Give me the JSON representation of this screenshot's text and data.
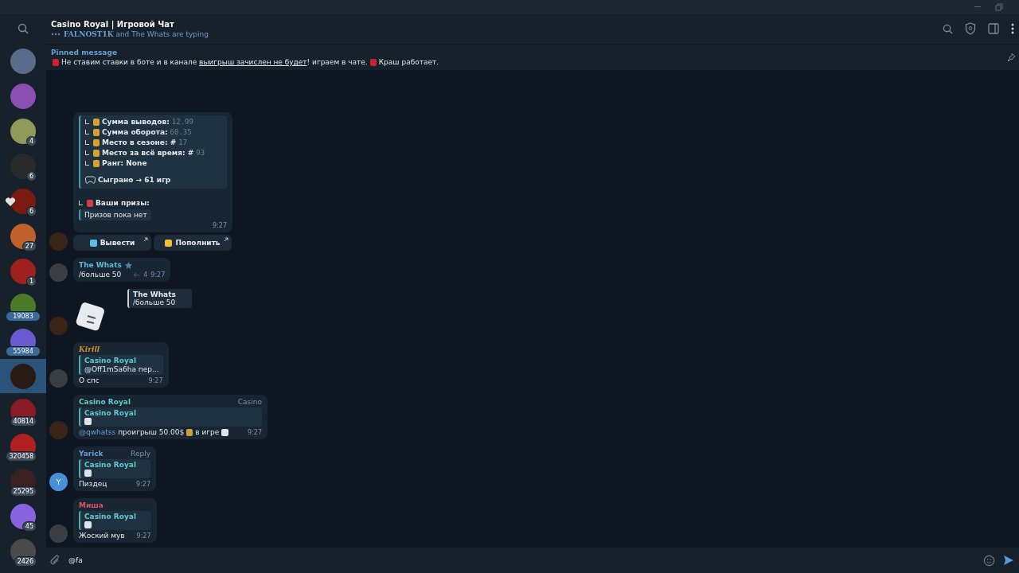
{
  "header": {
    "title": "Casino Royal | Игровой Чат",
    "typing": "**FALNOST1K** and The Whats are typing"
  },
  "pinned": {
    "label": "Pinned message",
    "before": "Не ставим ставки в боте и в канале ",
    "link": "выигрыш зачислен не будет",
    "after": "! играем в чате.",
    "tail": "Краш работает."
  },
  "sidebar": [
    {
      "color": "#5b6b8a",
      "selected": false,
      "heart": false
    },
    {
      "color": "#8a4fb0",
      "selected": false,
      "heart": false
    },
    {
      "color": "#8f9a5a",
      "badge": "4",
      "selected": false,
      "heart": false,
      "muted": true
    },
    {
      "color": "#2a2a2a",
      "badge": "6",
      "selected": false,
      "heart": false,
      "muted": true
    },
    {
      "color": "#7a1a10",
      "badge": "6",
      "selected": false,
      "heart": true,
      "muted": true
    },
    {
      "color": "#c0602a",
      "badge": "27",
      "selected": false,
      "heart": false,
      "muted": true
    },
    {
      "color": "#a02020",
      "badge": "1",
      "selected": false,
      "heart": false,
      "muted": true
    },
    {
      "color": "#4a7a2a",
      "badge": "19083",
      "selected": false,
      "heart": false,
      "muted": false
    },
    {
      "color": "#6a5ad0",
      "badge": "55984",
      "selected": false,
      "heart": false,
      "muted": false
    },
    {
      "color": "#2a1a14",
      "selected": true,
      "heart": false
    },
    {
      "color": "#8a1a24",
      "badge": "40814",
      "selected": false,
      "heart": false,
      "muted": true
    },
    {
      "color": "#b02020",
      "badge": "320458",
      "selected": false,
      "heart": false,
      "muted": true
    },
    {
      "color": "#3a2020",
      "badge": "25295",
      "selected": false,
      "heart": false,
      "muted": true
    },
    {
      "color": "#8a62e0",
      "badge": "45",
      "selected": false,
      "heart": false,
      "muted": true
    },
    {
      "color": "#4a4a4a",
      "badge": "2426",
      "selected": false,
      "heart": false,
      "muted": true
    }
  ],
  "messages": [
    {
      "kind": "stats",
      "stats": [
        {
          "label": "Сумма выводов:",
          "value": "12.99"
        },
        {
          "label": "Сумма оборота:",
          "value": "60.35"
        },
        {
          "label": "Место в сезоне: #",
          "value": "17"
        },
        {
          "label": "Место за всё время: #",
          "value": "93"
        },
        {
          "label": "Ранг: None"
        }
      ],
      "played": "Сыграно → 61 игр",
      "prizes_title": "Ваши призы:",
      "prizes_quote": "Призов пока нет",
      "time": "9:27",
      "buttons": [
        "Вывести",
        "Пополнить"
      ]
    },
    {
      "kind": "text",
      "sender": "The Whats",
      "color": "#5fb8d8",
      "text": "/больше 50",
      "replies": "4",
      "time": "9:27"
    },
    {
      "kind": "sticker",
      "reply_name": "The Whats",
      "reply_text": "/больше 50"
    },
    {
      "kind": "text",
      "sender": "Kirill",
      "color": "#d0902a",
      "quote_name": "Casino Royal",
      "quote_text": "@Off1mSa6ha пер...",
      "text": "О спс",
      "time": "9:27"
    },
    {
      "kind": "game",
      "sender": "Casino Royal",
      "color": "#64c8c8",
      "tag": "Casino",
      "quote_name": "Casino Royal",
      "mention": "@qwhatss",
      "text": "проигрыш 50.00$",
      "text2": "в игре",
      "time": "9:27"
    },
    {
      "kind": "text",
      "sender": "Yarick",
      "color": "#6a9ad8",
      "tag": "Reply",
      "avatar_letter": "Y",
      "quote_name": "Casino Royal",
      "text": "Пиздец",
      "time": "9:27"
    },
    {
      "kind": "text",
      "sender": "Миша",
      "color": "#e0506a",
      "quote_name": "Casino Royal",
      "text": "Жоский мув",
      "time": "9:27"
    }
  ],
  "input": {
    "value": "@fa"
  }
}
